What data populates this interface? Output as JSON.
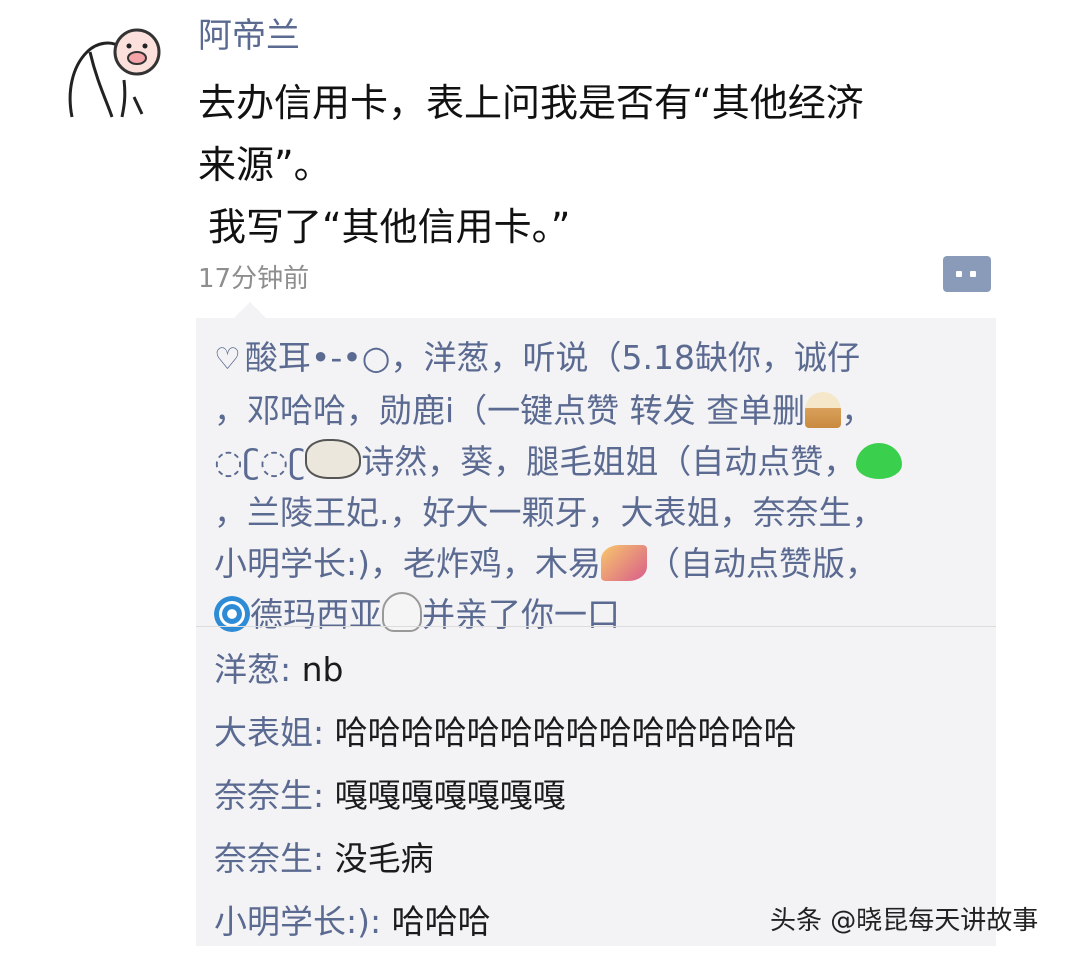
{
  "post": {
    "username": "阿帝兰",
    "text_lines": [
      "去办信用卡，表上问我是否有“其他经济",
      "来源”。",
      "我写了“其他信用卡。”"
    ],
    "timestamp": "17分钟前"
  },
  "likes": {
    "icon": "heart-outline-icon",
    "lines": [
      [
        "酸耳•-•○，洋葱，听说（5.18缺你，诚仔"
      ],
      [
        "，邓哈哈，勋鹿i（一键点赞 转发 查单删",
        {
          "emoji": "ice-cream"
        },
        "，"
      ],
      [
        "◌ʗ◌ʗ",
        {
          "emoji": "sheep"
        },
        "诗然，葵，腿毛姐姐（自动点赞，",
        {
          "emoji": "green-heart"
        }
      ],
      [
        "，兰陵王妃.，好大一颗牙，大表姐，奈奈生，"
      ],
      [
        "小明学长:)，老炸鸡，木易",
        {
          "emoji": "nail-polish"
        },
        "（自动点赞版，"
      ],
      [
        {
          "emoji": "cyclone"
        },
        "德玛西亚",
        {
          "emoji": "ghost"
        },
        "并亲了你一口"
      ]
    ]
  },
  "comments": [
    {
      "author": "洋葱",
      "text": "nb"
    },
    {
      "author": "大表姐",
      "text": "哈哈哈哈哈哈哈哈哈哈哈哈哈哈"
    },
    {
      "author": "奈奈生",
      "text": "嘎嘎嘎嘎嘎嘎嘎"
    },
    {
      "author": "奈奈生",
      "text": "没毛病"
    },
    {
      "author": "小明学长:)",
      "text": "哈哈哈"
    }
  ],
  "watermark": "头条 @晓昆每天讲故事",
  "colors": {
    "name": "#5b6a91",
    "panel": "#f3f3f5",
    "comment_button": "#8a9bb9"
  }
}
